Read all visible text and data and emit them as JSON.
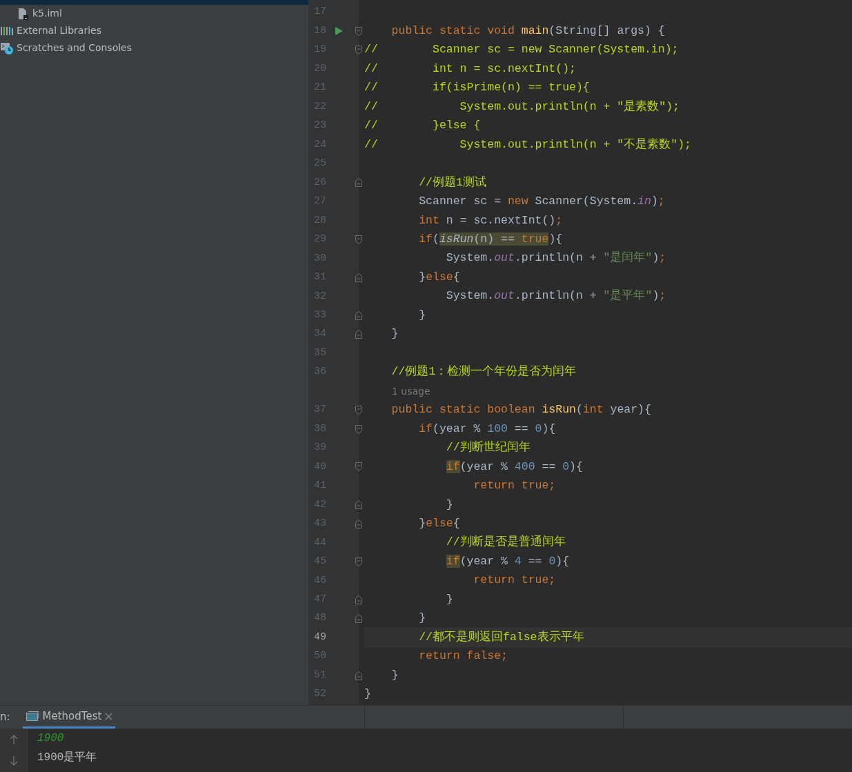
{
  "project_tree": [
    {
      "children": [
        {
          "label": "k5.iml",
          "kind": "file"
        }
      ]
    },
    {
      "label": "External Libraries",
      "kind": "libraries"
    },
    {
      "label": "Scratches and Consoles",
      "kind": "scratches"
    }
  ],
  "editor": {
    "lines": [
      {
        "number": "17"
      },
      {
        "number": "18",
        "run_marker": true,
        "fold_open": true,
        "tokens": [
          {
            "kind": "keyword",
            "text": "    public static void "
          },
          {
            "kind": "function",
            "text": "main"
          },
          {
            "kind": "plain",
            "text": "(String[] args) {"
          }
        ]
      },
      {
        "number": "19",
        "fold_open": true,
        "tokens": [
          {
            "kind": "comment",
            "text": "//        Scanner sc = new Scanner(System.in);"
          }
        ]
      },
      {
        "number": "20",
        "tokens": [
          {
            "kind": "comment",
            "text": "//        int n = sc.nextInt();"
          }
        ]
      },
      {
        "number": "21",
        "tokens": [
          {
            "kind": "comment",
            "text": "//        if(isPrime(n) == true){"
          }
        ]
      },
      {
        "number": "22",
        "tokens": [
          {
            "kind": "comment",
            "text": "//            System.out.println(n + \"是素数\");"
          }
        ]
      },
      {
        "number": "23",
        "tokens": [
          {
            "kind": "comment",
            "text": "//        }else {"
          }
        ]
      },
      {
        "number": "24",
        "tokens": [
          {
            "kind": "comment",
            "text": "//            System.out.println(n + \"不是素数\");"
          }
        ]
      },
      {
        "number": "25"
      },
      {
        "number": "26",
        "fold_close": true,
        "tokens": [
          {
            "kind": "comment",
            "text": "        //例题1测试"
          }
        ]
      },
      {
        "number": "27",
        "tokens": [
          {
            "kind": "plain",
            "text": "        Scanner sc = "
          },
          {
            "kind": "keyword",
            "text": "new "
          },
          {
            "kind": "plain",
            "text": "Scanner(System."
          },
          {
            "kind": "field",
            "text": "in"
          },
          {
            "kind": "plain",
            "text": ")"
          },
          {
            "kind": "keyword",
            "text": ";"
          }
        ]
      },
      {
        "number": "28",
        "tokens": [
          {
            "kind": "keyword",
            "text": "        int "
          },
          {
            "kind": "plain",
            "text": "n = sc.nextInt()"
          },
          {
            "kind": "keyword",
            "text": ";"
          }
        ]
      },
      {
        "number": "29",
        "fold_open": true,
        "tokens": [
          {
            "kind": "keyword",
            "text": "        if"
          },
          {
            "kind": "plain",
            "text": "("
          },
          {
            "kind": "call",
            "text": "isRun",
            "highlighted": true
          },
          {
            "kind": "plain",
            "text": "(n) == ",
            "highlighted": true
          },
          {
            "kind": "keyword",
            "text": "true",
            "highlighted": true
          },
          {
            "kind": "plain",
            "text": "){"
          }
        ]
      },
      {
        "number": "30",
        "tokens": [
          {
            "kind": "plain",
            "text": "            System."
          },
          {
            "kind": "field",
            "text": "out"
          },
          {
            "kind": "plain",
            "text": ".println(n + "
          },
          {
            "kind": "string",
            "text": "\"是闰年\""
          },
          {
            "kind": "plain",
            "text": ")"
          },
          {
            "kind": "keyword",
            "text": ";"
          }
        ]
      },
      {
        "number": "31",
        "fold_close": true,
        "tokens": [
          {
            "kind": "plain",
            "text": "        }"
          },
          {
            "kind": "keyword",
            "text": "else"
          },
          {
            "kind": "plain",
            "text": "{"
          }
        ]
      },
      {
        "number": "32",
        "tokens": [
          {
            "kind": "plain",
            "text": "            System."
          },
          {
            "kind": "field",
            "text": "out"
          },
          {
            "kind": "plain",
            "text": ".println(n + "
          },
          {
            "kind": "string",
            "text": "\"是平年\""
          },
          {
            "kind": "plain",
            "text": ")"
          },
          {
            "kind": "keyword",
            "text": ";"
          }
        ]
      },
      {
        "number": "33",
        "fold_close": true,
        "tokens": [
          {
            "kind": "plain",
            "text": "        }"
          }
        ]
      },
      {
        "number": "34",
        "fold_close": true,
        "tokens": [
          {
            "kind": "plain",
            "text": "    }"
          }
        ]
      },
      {
        "number": "35"
      },
      {
        "number": "36",
        "tokens": [
          {
            "kind": "comment",
            "text": "    //例题1：检测一个年份是否为闰年"
          }
        ]
      },
      {
        "kind": "hint",
        "text": "1 usage"
      },
      {
        "number": "37",
        "fold_open": true,
        "tokens": [
          {
            "kind": "keyword",
            "text": "    public static boolean "
          },
          {
            "kind": "function",
            "text": "isRun"
          },
          {
            "kind": "plain",
            "text": "("
          },
          {
            "kind": "keyword",
            "text": "int "
          },
          {
            "kind": "plain",
            "text": "year){"
          }
        ]
      },
      {
        "number": "38",
        "fold_open": true,
        "tokens": [
          {
            "kind": "keyword",
            "text": "        if"
          },
          {
            "kind": "plain",
            "text": "(year % "
          },
          {
            "kind": "number",
            "text": "100"
          },
          {
            "kind": "plain",
            "text": " == "
          },
          {
            "kind": "number",
            "text": "0"
          },
          {
            "kind": "plain",
            "text": "){"
          }
        ]
      },
      {
        "number": "39",
        "tokens": [
          {
            "kind": "comment",
            "text": "            //判断世纪闰年"
          }
        ]
      },
      {
        "number": "40",
        "fold_open": true,
        "tokens": [
          {
            "kind": "keyword",
            "text": "            if",
            "highlighted": true
          },
          {
            "kind": "plain",
            "text": "(year % "
          },
          {
            "kind": "number",
            "text": "400"
          },
          {
            "kind": "plain",
            "text": " == "
          },
          {
            "kind": "number",
            "text": "0"
          },
          {
            "kind": "plain",
            "text": "){"
          }
        ]
      },
      {
        "number": "41",
        "tokens": [
          {
            "kind": "keyword",
            "text": "                return true;"
          }
        ]
      },
      {
        "number": "42",
        "fold_close": true,
        "tokens": [
          {
            "kind": "plain",
            "text": "            }"
          }
        ]
      },
      {
        "number": "43",
        "fold_close": true,
        "tokens": [
          {
            "kind": "plain",
            "text": "        }"
          },
          {
            "kind": "keyword",
            "text": "else"
          },
          {
            "kind": "plain",
            "text": "{"
          }
        ]
      },
      {
        "number": "44",
        "tokens": [
          {
            "kind": "comment",
            "text": "            //判断是否是普通闰年"
          }
        ]
      },
      {
        "number": "45",
        "fold_open": true,
        "tokens": [
          {
            "kind": "keyword",
            "text": "            if",
            "highlighted": true
          },
          {
            "kind": "plain",
            "text": "(year % "
          },
          {
            "kind": "number",
            "text": "4"
          },
          {
            "kind": "plain",
            "text": " == "
          },
          {
            "kind": "number",
            "text": "0"
          },
          {
            "kind": "plain",
            "text": "){"
          }
        ]
      },
      {
        "number": "46",
        "tokens": [
          {
            "kind": "keyword",
            "text": "                return true;"
          }
        ]
      },
      {
        "number": "47",
        "fold_close": true,
        "tokens": [
          {
            "kind": "plain",
            "text": "            }"
          }
        ]
      },
      {
        "number": "48",
        "fold_close": true,
        "tokens": [
          {
            "kind": "plain",
            "text": "        }"
          }
        ]
      },
      {
        "number": "49",
        "current": true,
        "tokens": [
          {
            "kind": "comment",
            "text": "        //都不是则返回false表示平年"
          }
        ]
      },
      {
        "number": "50",
        "tokens": [
          {
            "kind": "keyword",
            "text": "        return false;"
          }
        ]
      },
      {
        "number": "51",
        "fold_close": true,
        "tokens": [
          {
            "kind": "plain",
            "text": "    }"
          }
        ]
      },
      {
        "number": "52",
        "tokens": [
          {
            "kind": "plain",
            "text": "}"
          }
        ]
      }
    ]
  },
  "run_panel": {
    "label": "n:",
    "tabs": [
      {
        "label": "MethodTest",
        "selected": true
      }
    ],
    "console": [
      {
        "kind": "input",
        "text": "1900"
      },
      {
        "kind": "output",
        "text": "1900是平年"
      }
    ]
  }
}
